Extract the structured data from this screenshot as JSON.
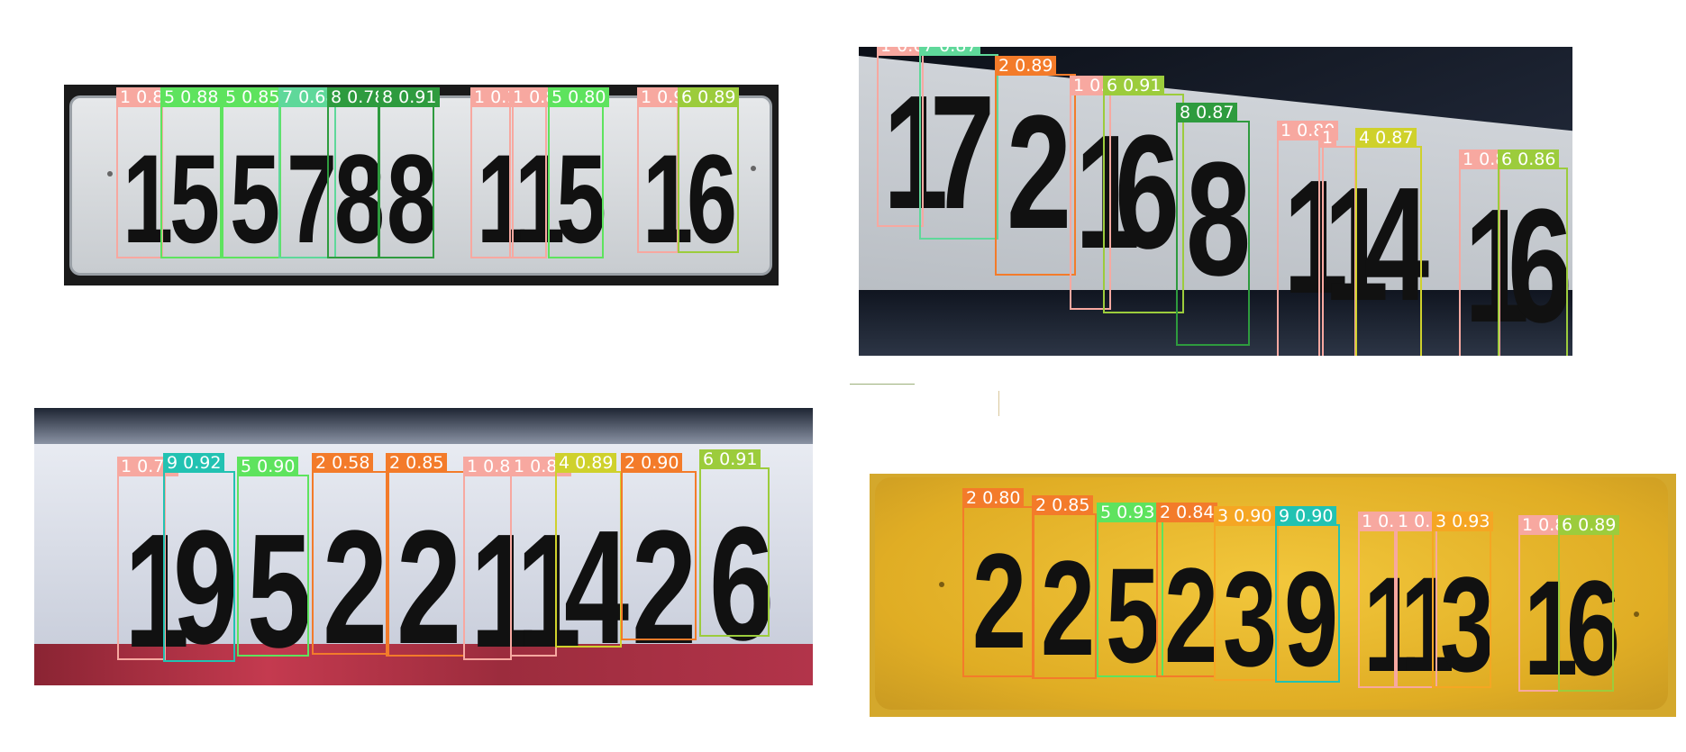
{
  "colors": {
    "pink": "#f7a8a0",
    "green": "#5ee35e",
    "darkgreen": "#2e9b3e",
    "mint": "#5fd89a",
    "orange": "#f37b2a",
    "lime": "#9ccc3c",
    "yellow": "#cfd12c",
    "teal": "#22c2b2",
    "amber": "#f5a623"
  },
  "plates": [
    {
      "name": "plate-top-left",
      "detections": [
        {
          "label": "1 0.8",
          "char": "1",
          "color": "pink"
        },
        {
          "label": "5 0.88",
          "char": "5",
          "color": "green"
        },
        {
          "label": "5 0.85",
          "char": "5",
          "color": "green"
        },
        {
          "label": "7 0.68",
          "char": "7",
          "color": "mint"
        },
        {
          "label": "8 0.78",
          "char": "8",
          "color": "darkgreen"
        },
        {
          "label": "8 0.91",
          "char": "8",
          "color": "darkgreen"
        },
        {
          "label": "1 0.1",
          "char": "1",
          "color": "pink"
        },
        {
          "label": "1 0.87",
          "char": "1",
          "color": "pink"
        },
        {
          "label": "5 0.80",
          "char": "5",
          "color": "green"
        },
        {
          "label": "1 0.9",
          "char": "1",
          "color": "pink"
        },
        {
          "label": "6 0.89",
          "char": "6",
          "color": "lime"
        }
      ]
    },
    {
      "name": "plate-top-right",
      "detections": [
        {
          "label": "1 0.6",
          "char": "1",
          "color": "pink"
        },
        {
          "label": "7 0.87",
          "char": "7",
          "color": "mint"
        },
        {
          "label": "2 0.89",
          "char": "2",
          "color": "orange"
        },
        {
          "label": "1 0.6",
          "char": "1",
          "color": "pink"
        },
        {
          "label": "6 0.91",
          "char": "6",
          "color": "lime"
        },
        {
          "label": "8 0.87",
          "char": "8",
          "color": "darkgreen"
        },
        {
          "label": "1 0.80",
          "char": "1",
          "color": "pink"
        },
        {
          "label": "1",
          "char": "1",
          "color": "pink"
        },
        {
          "label": "4 0.87",
          "char": "4",
          "color": "yellow"
        },
        {
          "label": "1 0.8",
          "char": "1",
          "color": "pink"
        },
        {
          "label": "6 0.86",
          "char": "6",
          "color": "lime"
        }
      ]
    },
    {
      "name": "plate-bottom-left",
      "detections": [
        {
          "label": "1 0.79",
          "char": "1",
          "color": "pink"
        },
        {
          "label": "9 0.92",
          "char": "9",
          "color": "teal"
        },
        {
          "label": "5 0.90",
          "char": "5",
          "color": "green"
        },
        {
          "label": "2 0.58",
          "char": "2",
          "color": "orange"
        },
        {
          "label": "2 0.85",
          "char": "2",
          "color": "orange"
        },
        {
          "label": "1 0.86",
          "char": "1",
          "color": "pink"
        },
        {
          "label": "1 0.84",
          "char": "1",
          "color": "pink"
        },
        {
          "label": "4 0.89",
          "char": "4",
          "color": "yellow"
        },
        {
          "label": "2 0.90",
          "char": "2",
          "color": "orange"
        },
        {
          "label": "6 0.91",
          "char": "6",
          "color": "lime"
        }
      ]
    },
    {
      "name": "plate-bottom-right",
      "detections": [
        {
          "label": "2 0.80",
          "char": "2",
          "color": "orange"
        },
        {
          "label": "2 0.85",
          "char": "2",
          "color": "orange"
        },
        {
          "label": "5 0.93",
          "char": "5",
          "color": "green"
        },
        {
          "label": "2 0.84",
          "char": "2",
          "color": "orange"
        },
        {
          "label": "3 0.90",
          "char": "3",
          "color": "amber"
        },
        {
          "label": "9 0.90",
          "char": "9",
          "color": "teal"
        },
        {
          "label": "1 0.1",
          "char": "1",
          "color": "pink"
        },
        {
          "label": "1 0.",
          "char": "1",
          "color": "pink"
        },
        {
          "label": "3 0.93",
          "char": "3",
          "color": "amber"
        },
        {
          "label": "1 0.8",
          "char": "1",
          "color": "pink"
        },
        {
          "label": "6 0.89",
          "char": "6",
          "color": "lime"
        }
      ]
    }
  ]
}
